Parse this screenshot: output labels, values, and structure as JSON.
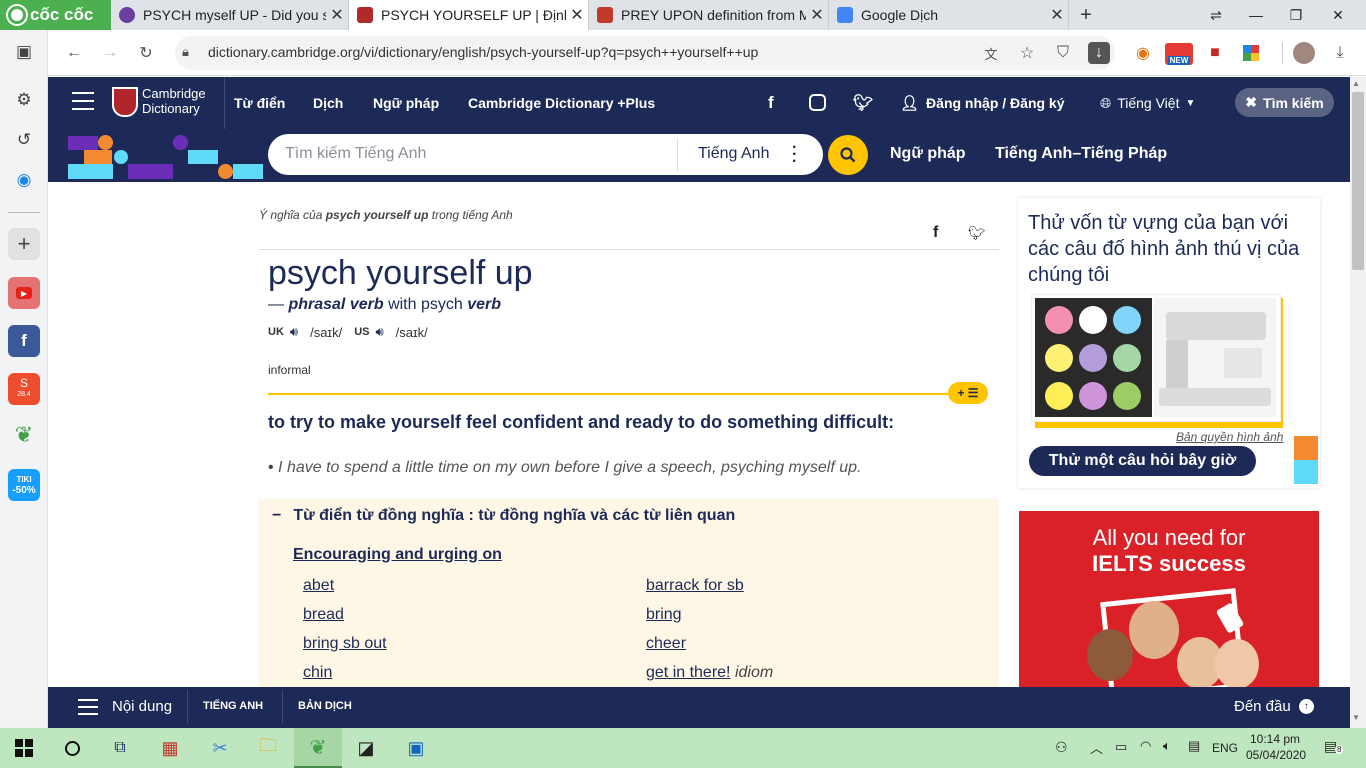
{
  "browser": {
    "brand": "cốc cốc",
    "tabs": [
      {
        "title": "PSYCH myself UP - Did you sp",
        "favicon_color": "#6a3fa0"
      },
      {
        "title": "PSYCH YOURSELF UP | Định n",
        "favicon_color": "#b02a2a"
      },
      {
        "title": "PREY UPON definition from M",
        "favicon_color": "#c0392b"
      },
      {
        "title": "Google Dịch",
        "favicon_color": "#4285f4"
      }
    ],
    "new_tab": "+",
    "url": "dictionary.cambridge.org/vi/dictionary/english/psych-yourself-up?q=psych++yourself++up",
    "ext_badge": "NEW"
  },
  "sidebar": {
    "shopee_badge": "28.4",
    "tiki_label": "TIKI",
    "tiki_discount": "-50%"
  },
  "site": {
    "logo_line1": "Cambridge",
    "logo_line2": "Dictionary",
    "nav": [
      "Từ điển",
      "Dịch",
      "Ngữ pháp",
      "Cambridge Dictionary +Plus"
    ],
    "login": "Đăng nhập / Đăng ký",
    "language": "Tiếng Việt",
    "search_button": "Tìm kiếm",
    "search_placeholder": "Tìm kiếm Tiếng Anh",
    "search_lang": "Tiếng Anh",
    "sub_nav": [
      "Ngữ pháp",
      "Tiếng Anh–Tiếng Pháp"
    ]
  },
  "entry": {
    "breadcrumb_pre": "Ý nghĩa của ",
    "breadcrumb_word": "psych yourself up",
    "breadcrumb_post": " trong tiếng Anh",
    "headword": "psych yourself up",
    "pos_dash": "—",
    "pos": "phrasal verb",
    "pos_with": "with psych",
    "pos_verb": "verb",
    "uk_label": "UK",
    "uk_pron": "/saɪk/",
    "us_label": "US",
    "us_pron": "/saɪk/",
    "register": "informal",
    "definition": "to try to make yourself feel confident and ready to do something difficult:",
    "example": "I have to spend a little time on my own before I give a speech, psyching myself up.",
    "thesaurus_title": "Từ điển từ đồng nghĩa : từ đồng nghĩa và các từ liên quan",
    "thesaurus_group": "Encouraging and urging on",
    "thesaurus_left": [
      "abet",
      "bread",
      "bring sb out",
      "chin"
    ],
    "thesaurus_right": [
      "barrack for sb",
      "bring",
      "cheer",
      "get in there!"
    ],
    "idiom_label": "idiom"
  },
  "quiz": {
    "text": "Thử vốn từ vựng của bạn với các câu đố hình ảnh thú vị của chúng tôi",
    "credit": "Bản quyền hình ảnh",
    "button": "Thử một câu hỏi bây giờ"
  },
  "ad": {
    "line1": "All you need for",
    "line2": "IELTS success"
  },
  "bottom": {
    "contents": "Nội dung",
    "tab_english": "TIẾNG ANH",
    "tab_translation": "BẢN DỊCH",
    "to_top": "Đến đầu"
  },
  "taskbar": {
    "language": "ENG",
    "time": "10:14 pm",
    "date": "05/04/2020",
    "notifications": "8"
  }
}
